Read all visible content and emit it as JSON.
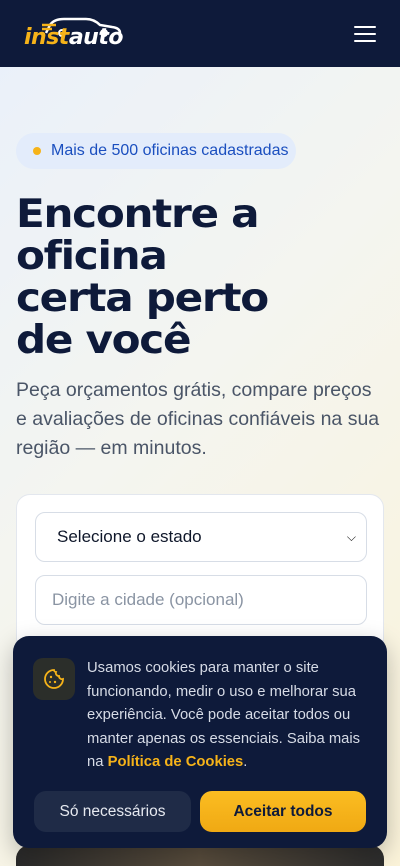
{
  "header": {
    "logo_part1": "inst",
    "logo_part2": "auto",
    "menu_icon": "hamburger-menu-icon"
  },
  "hero": {
    "badge_text": "Mais de 500 oficinas cadastradas",
    "title_line1": "Encontre a",
    "title_line2": "oficina",
    "title_line3": "certa perto",
    "title_line4": "de você",
    "subtitle": "Peça orçamentos grátis, compare preços e avaliações de oficinas confiáveis na sua região — em minutos."
  },
  "search_form": {
    "state_select_value": "Selecione o estado",
    "city_placeholder": "Digite a cidade (opcional)"
  },
  "cookie_banner": {
    "icon": "cookie-icon",
    "text": "Usamos cookies para manter o site funcionando, medir o uso e melhorar sua experiência. Você pode aceitar todos ou manter apenas os essenciais. Saiba mais na ",
    "link_text": "Política de Cookies",
    "text_end": ".",
    "necessary_label": "Só necessários",
    "accept_label": "Aceitar todos"
  },
  "colors": {
    "navy": "#0e1a3a",
    "accent": "#f6b319",
    "badge_text": "#1b4fbf"
  }
}
